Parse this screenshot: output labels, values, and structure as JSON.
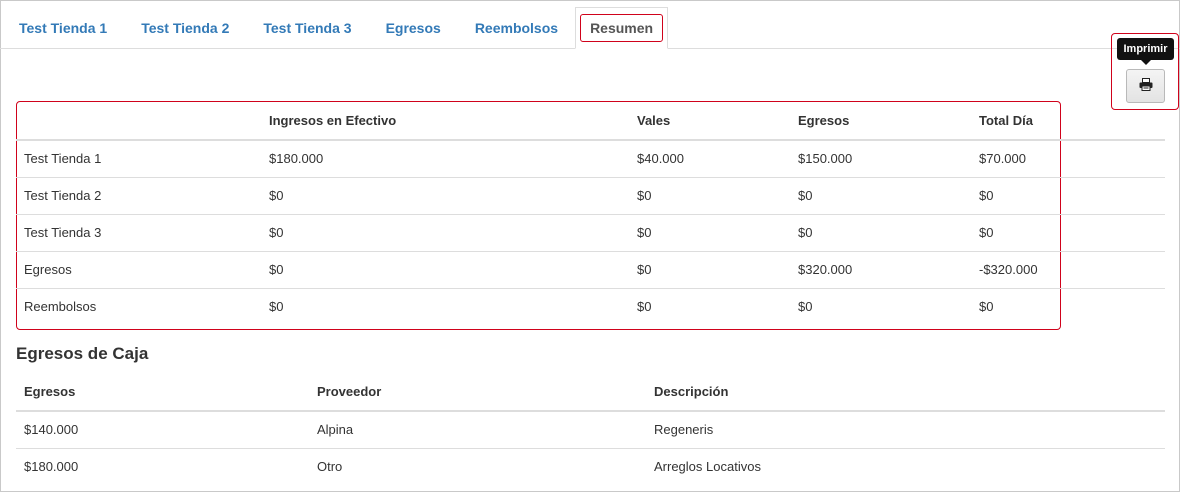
{
  "tabs": [
    {
      "label": "Test Tienda 1",
      "active": false
    },
    {
      "label": "Test Tienda 2",
      "active": false
    },
    {
      "label": "Test Tienda 3",
      "active": false
    },
    {
      "label": "Egresos",
      "active": false
    },
    {
      "label": "Reembolsos",
      "active": false
    },
    {
      "label": "Resumen",
      "active": true
    }
  ],
  "print": {
    "tooltip": "Imprimir",
    "icon": "print-icon"
  },
  "summary": {
    "headers": [
      "",
      "Ingresos en Efectivo",
      "Vales",
      "Egresos",
      "Total Día"
    ],
    "rows": [
      [
        "Test Tienda 1",
        "$180.000",
        "$40.000",
        "$150.000",
        "$70.000"
      ],
      [
        "Test Tienda 2",
        "$0",
        "$0",
        "$0",
        "$0"
      ],
      [
        "Test Tienda 3",
        "$0",
        "$0",
        "$0",
        "$0"
      ],
      [
        "Egresos",
        "$0",
        "$0",
        "$320.000",
        "-$320.000"
      ],
      [
        "Reembolsos",
        "$0",
        "$0",
        "$0",
        "$0"
      ]
    ]
  },
  "egresos_caja": {
    "title": "Egresos de Caja",
    "headers": [
      "Egresos",
      "Proveedor",
      "Descripción"
    ],
    "rows": [
      [
        "$140.000",
        "Alpina",
        "Regeneris"
      ],
      [
        "$180.000",
        "Otro",
        "Arreglos Locativos"
      ]
    ]
  },
  "colors": {
    "link": "#337ab7",
    "highlight": "#d0021b"
  }
}
